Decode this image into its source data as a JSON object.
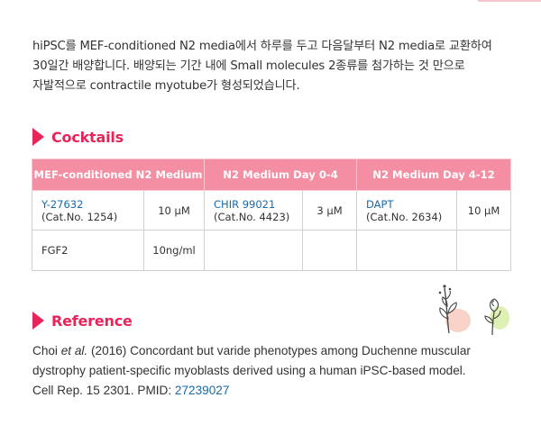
{
  "intro": {
    "line1": "hiPSC를 MEF-conditioned N2 media에서 하루를 두고 다음달부터 N2 media로 교환하여",
    "line2": "30일간 배양합니다. 배양되는 기간 내에 Small molecules 2종류를 첨가하는 것 만으로",
    "line3": "자발적으로 contractile myotube가 형성되었습니다."
  },
  "cocktails": {
    "title": "Cocktails",
    "headers": [
      "MEF-conditioned N2 Medium",
      "N2 Medium Day 0-4",
      "N2 Medium Day 4-12"
    ],
    "row1": {
      "c1_name": "Y-27632",
      "c1_cat": "(Cat.No. 1254)",
      "c1_conc": "10 μM",
      "c2_name": "CHIR 99021",
      "c2_cat": "(Cat.No. 4423)",
      "c2_conc": "3 μM",
      "c3_name": "DAPT",
      "c3_cat": "(Cat.No. 2634)",
      "c3_conc": "10 μM"
    },
    "row2": {
      "c1_name": "FGF2",
      "c1_conc": "10ng/ml"
    }
  },
  "reference": {
    "title": "Reference",
    "author": "Choi ",
    "etal": "et al.",
    "line1_rest": " (2016) Concordant but varide phenotypes among Duchenne muscular",
    "line2": "dystrophy patient-specific myoblasts derived using a human iPSC-based model.",
    "line3_prefix": "Cell Rep. 15 2301. PMID: ",
    "pmid": "27239027"
  },
  "colors": {
    "accent": "#e8245a",
    "header_bg": "#f48ea3",
    "link": "#1a6aa8"
  }
}
